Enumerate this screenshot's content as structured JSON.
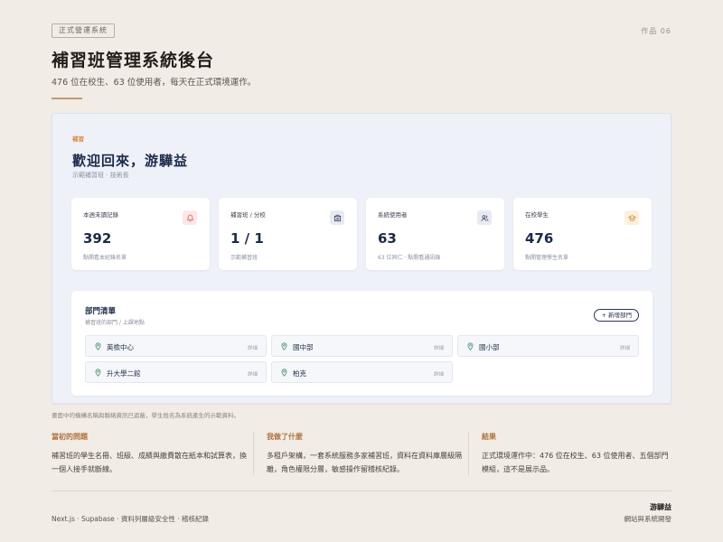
{
  "header": {
    "tag": "正式營運系統",
    "work_number": "作品 06",
    "title": "補習班管理系統後台",
    "subtitle": "476 位在校生、63 位使用者，每天在正式環境運作。"
  },
  "dashboard": {
    "eyebrow": "補習",
    "welcome": "歡迎回來，游驊益",
    "org_line": "示範補習班 · 技術長",
    "stats": [
      {
        "label": "本週未讀記錄",
        "value": "392",
        "sub": "點開看本紀錄名單",
        "icon": "bell-icon"
      },
      {
        "label": "補習班 / 分校",
        "value": "1 / 1",
        "sub": "示範補習班",
        "icon": "building-icon"
      },
      {
        "label": "系統使用者",
        "value": "63",
        "sub": "63 位同仁 · 點開看通訊錄",
        "icon": "users-icon"
      },
      {
        "label": "在校學生",
        "value": "476",
        "sub": "點開管理學生名單",
        "icon": "graduation-cap-icon"
      }
    ],
    "departments": {
      "title": "部門清單",
      "description": "補習班的部門 / 上課地點",
      "add_button": "+ 新增部門",
      "detail_label": "詳細",
      "items": [
        {
          "name": "英檢中心"
        },
        {
          "name": "國中部"
        },
        {
          "name": "國小部"
        },
        {
          "name": "升大學二館"
        },
        {
          "name": "柏克"
        }
      ]
    }
  },
  "caption": "畫面中的機構名稱與聯絡資訊已遮蔽，學生姓名為系統產生的示範資料。",
  "columns": [
    {
      "heading": "當初的問題",
      "text": "補習班的學生名冊、班級、成績與繳費散在紙本和試算表，換一個人接手就斷線。"
    },
    {
      "heading": "我做了什麼",
      "text": "多租戶架構，一套系統服務多家補習班，資料在資料庫層級隔離，角色權限分層，敏感操作留稽核紀錄。"
    },
    {
      "heading": "結果",
      "text": "正式環境運作中：476 位在校生、63 位使用者、五個部門模組，這不是展示品。"
    }
  ],
  "footer": {
    "stack": "Next.js · Supabase · 資料列層級安全性 · 稽核紀錄",
    "author": "游驊益",
    "role": "網站與系統開發"
  },
  "colors": {
    "accent": "#c79a6c",
    "navy": "#1b2a4a",
    "bell_bg": "#fde7e7",
    "building_bg": "#e7eaf1",
    "users_bg": "#e7eaf1",
    "cap_bg": "#fdf0dc",
    "pin": "#3f8c6a"
  }
}
